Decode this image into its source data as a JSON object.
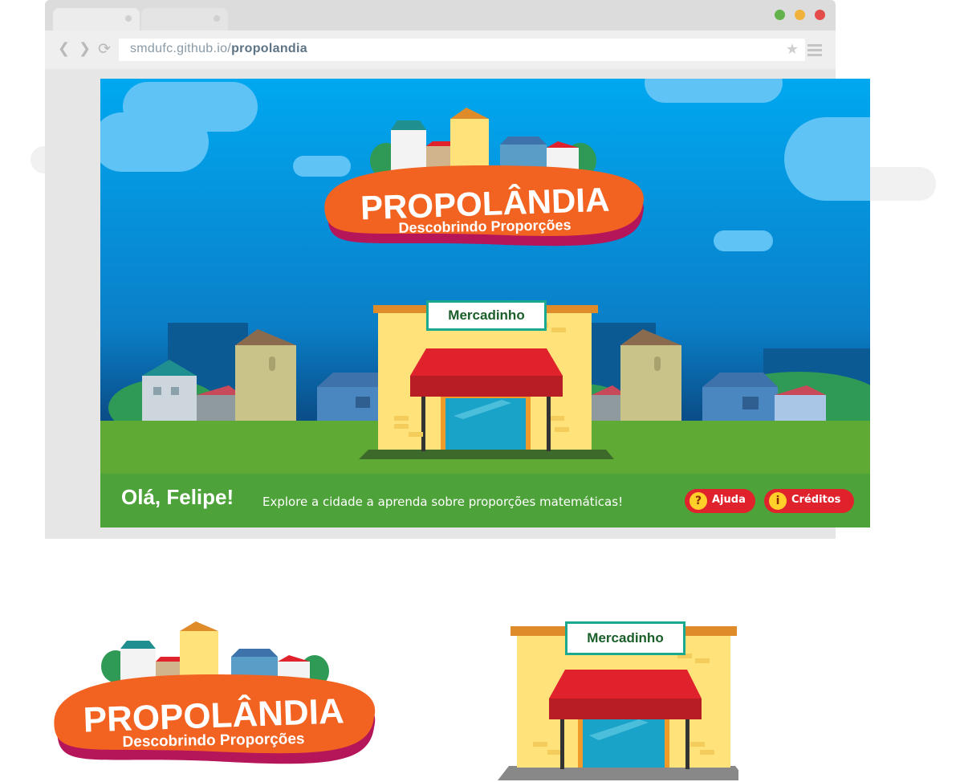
{
  "browser": {
    "url_domain": "smdufc.github.io/",
    "url_path": "propolandia",
    "traffic_light_colors": [
      "#62b34a",
      "#f0b23a",
      "#e44b4b"
    ]
  },
  "game": {
    "title": "PROPOLÂNDIA",
    "subtitle": "Descobrindo Proporções",
    "store_sign": "Mercadinho",
    "greeting": "Olá, Felipe!",
    "tagline": "Explore a cidade a aprenda sobre proporções matemáticas!",
    "help_button": {
      "icon": "?",
      "label": "Ajuda"
    },
    "credits_button": {
      "icon": "i",
      "label": "Créditos"
    }
  },
  "assets": {
    "logo_title": "PROPOLÂNDIA",
    "logo_subtitle": "Descobrindo Proporções",
    "store_sign": "Mercadinho"
  },
  "colors": {
    "sky": "#00a8f0",
    "grass": "#5faa35",
    "banner_orange": "#f26322",
    "awning_red": "#e0222c",
    "store_yellow": "#ffe27a"
  }
}
